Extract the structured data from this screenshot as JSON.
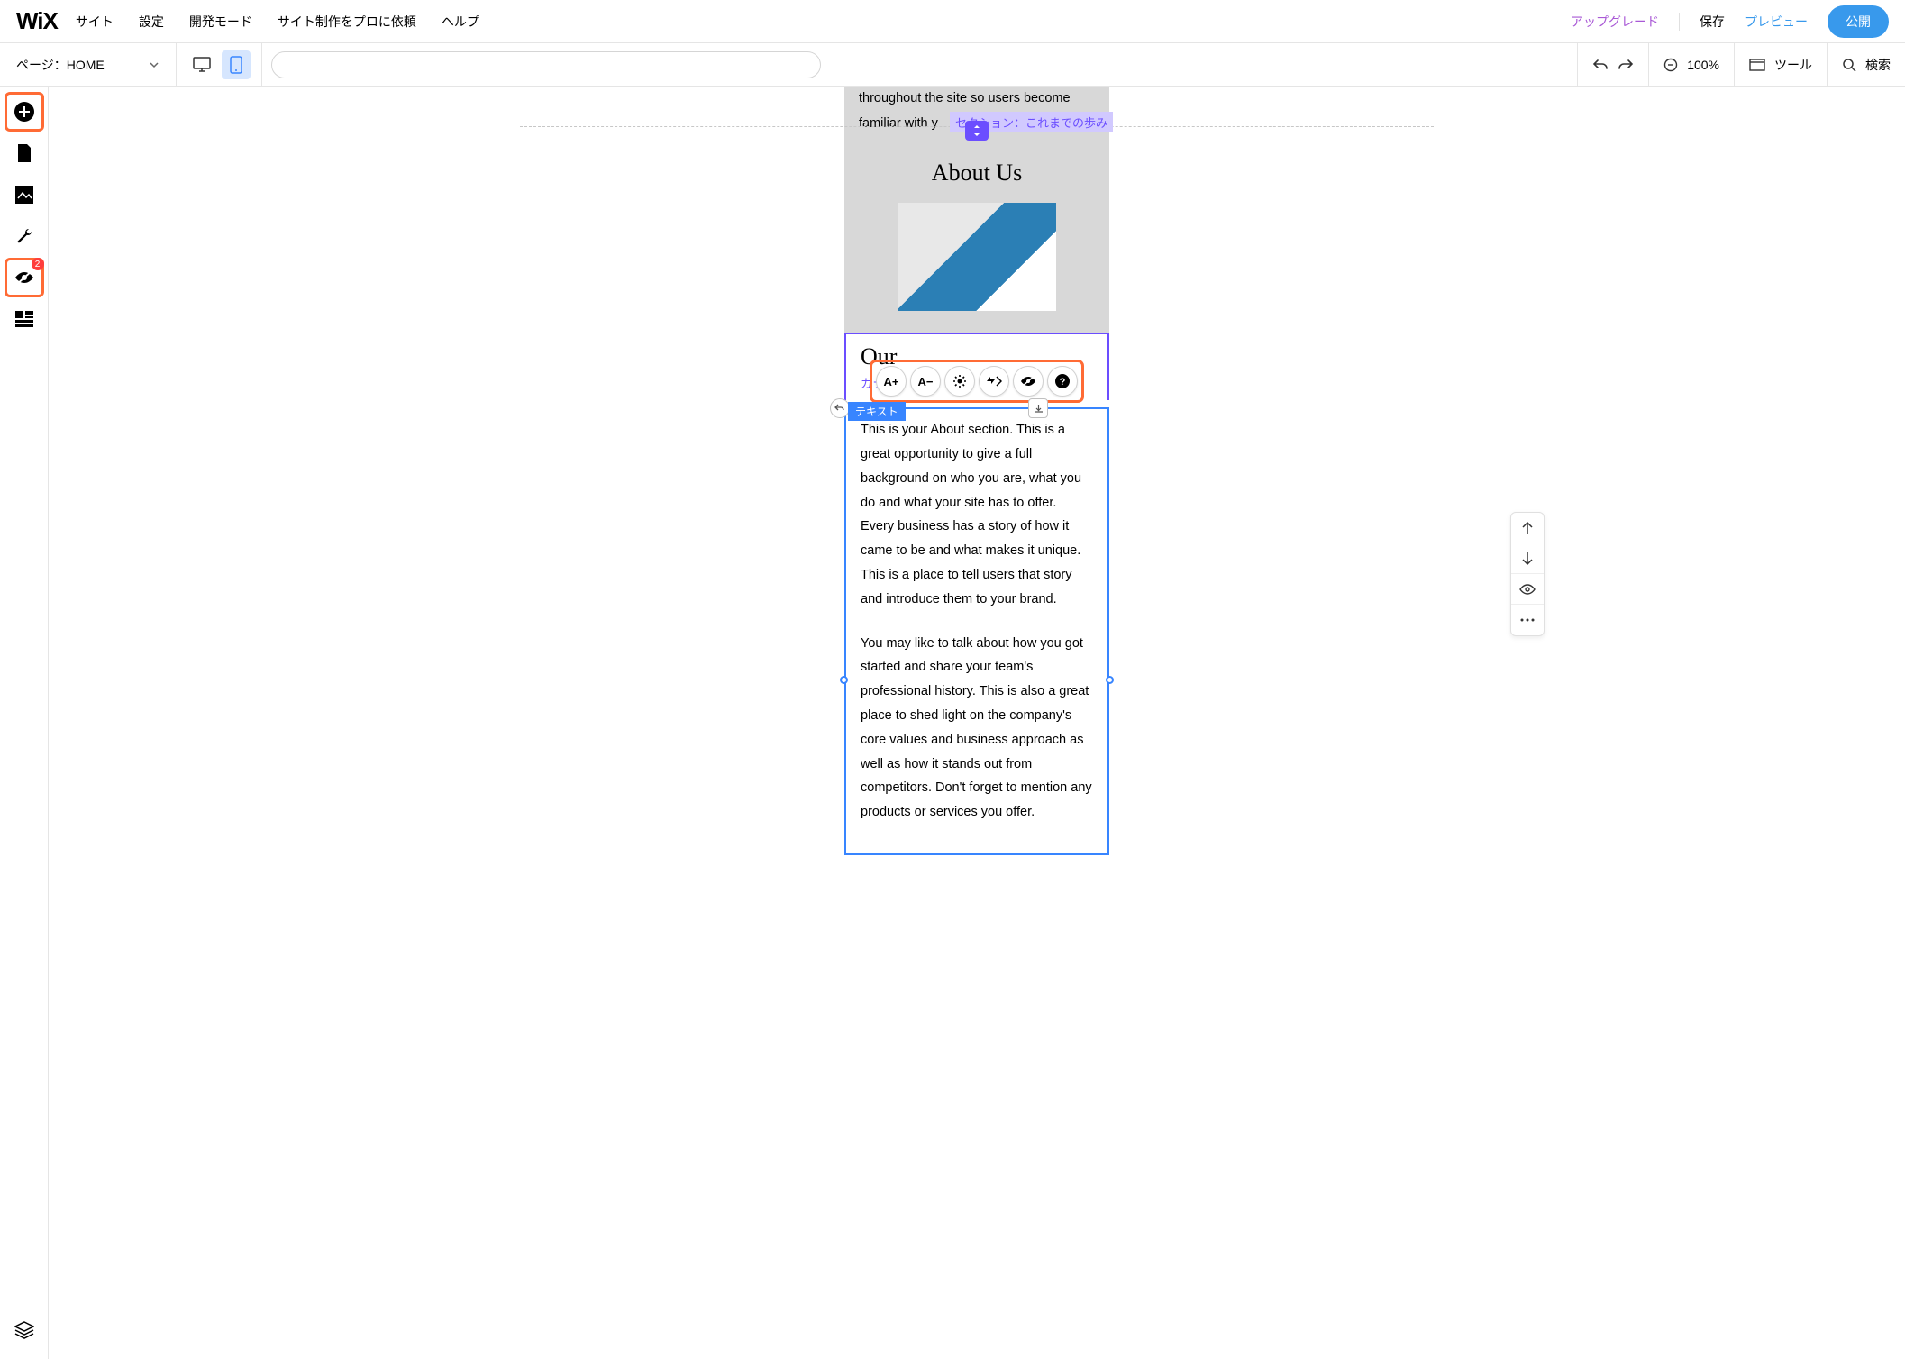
{
  "logo": "WiX",
  "menu": {
    "site": "サイト",
    "settings": "設定",
    "devmode": "開発モード",
    "hire": "サイト制作をプロに依頼",
    "help": "ヘルプ"
  },
  "topbar": {
    "upgrade": "アップグレード",
    "save": "保存",
    "preview": "プレビュー",
    "publish": "公開"
  },
  "secondbar": {
    "page_prefix": "ページ：",
    "page_name": "HOME",
    "zoom": "100%",
    "tools": "ツール",
    "search": "検索"
  },
  "leftrail": {
    "hidden_badge": "2"
  },
  "canvas": {
    "cut_text": "throughout the site so users become familiar with y",
    "section_label": "セクション：これまでの歩み",
    "about_title": "About Us",
    "our_title": "Our",
    "column_label": "カラム 2",
    "selection_label": "テキスト",
    "p1": "This is your About section. This is a great opportunity to give a full background on who you are, what you do and what your site has to offer. Every business has a story of how it came to be and what makes it unique. This is a place to tell users that story and introduce them to your brand.",
    "p2": "You may like to talk about how you got started and share your team's professional history. This is also a great place to shed light on the company's core values and business approach as well as how it stands out from competitors. Don't forget to mention any products or services you offer."
  },
  "text_toolbar": {
    "inc": "A+",
    "dec": "A−"
  }
}
